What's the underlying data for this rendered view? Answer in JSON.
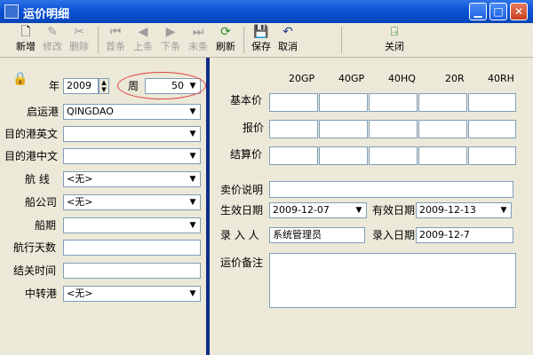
{
  "window": {
    "title": "运价明细"
  },
  "toolbar": {
    "new": "新增",
    "edit": "修改",
    "delete": "删除",
    "first": "首条",
    "prev": "上条",
    "next": "下条",
    "last": "末条",
    "refresh": "刷新",
    "save": "保存",
    "cancel": "取消",
    "close": "关闭"
  },
  "icons": {
    "new": "new-document-icon",
    "edit": "edit-icon",
    "delete": "scissors-icon",
    "first": "first-record-icon",
    "prev": "previous-record-icon",
    "next": "next-record-icon",
    "last": "last-record-icon",
    "refresh": "refresh-icon",
    "save": "floppy-disk-icon",
    "cancel": "undo-icon",
    "close": "exit-door-icon",
    "lock": "lock-icon"
  },
  "colors": {
    "titlebar": "#0a52d6",
    "divider": "#0c2c86",
    "highlight_circle": "#e04040"
  },
  "form": {
    "year_label": "年",
    "year_value": "2009",
    "week_label": "周",
    "week_value": "50",
    "origin_port_label": "启运港",
    "origin_port_value": "QINGDAO",
    "dest_port_en_label": "目的港英文",
    "dest_port_en_value": "",
    "dest_port_cn_label": "目的港中文",
    "dest_port_cn_value": "",
    "route_label": "航  线",
    "route_value": "<无>",
    "carrier_label": "船公司",
    "carrier_value": "<无>",
    "schedule_label": "船期",
    "schedule_value": "",
    "sailing_days_label": "航行天数",
    "sailing_days_value": "",
    "cutoff_time_label": "结关时间",
    "cutoff_time_value": "",
    "transit_port_label": "中转港",
    "transit_port_value": "<无>"
  },
  "rates": {
    "columns": [
      "20GP",
      "40GP",
      "40HQ",
      "20R",
      "40RH"
    ],
    "rows": [
      {
        "label": "基本价",
        "values": [
          "",
          "",
          "",
          "",
          ""
        ]
      },
      {
        "label": "报价",
        "values": [
          "",
          "",
          "",
          "",
          ""
        ]
      },
      {
        "label": "结算价",
        "values": [
          "",
          "",
          "",
          "",
          ""
        ]
      }
    ]
  },
  "details": {
    "sale_note_label": "卖价说明",
    "sale_note_value": "",
    "effective_date_label": "生效日期",
    "effective_date_value": "2009-12-07",
    "valid_date_label": "有效日期",
    "valid_date_value": "2009-12-13",
    "entered_by_label": "录 入 人",
    "entered_by_value": "系统管理员",
    "entry_date_label": "录入日期",
    "entry_date_value": "2009-12-7",
    "remarks_label": "运价备注",
    "remarks_value": ""
  }
}
